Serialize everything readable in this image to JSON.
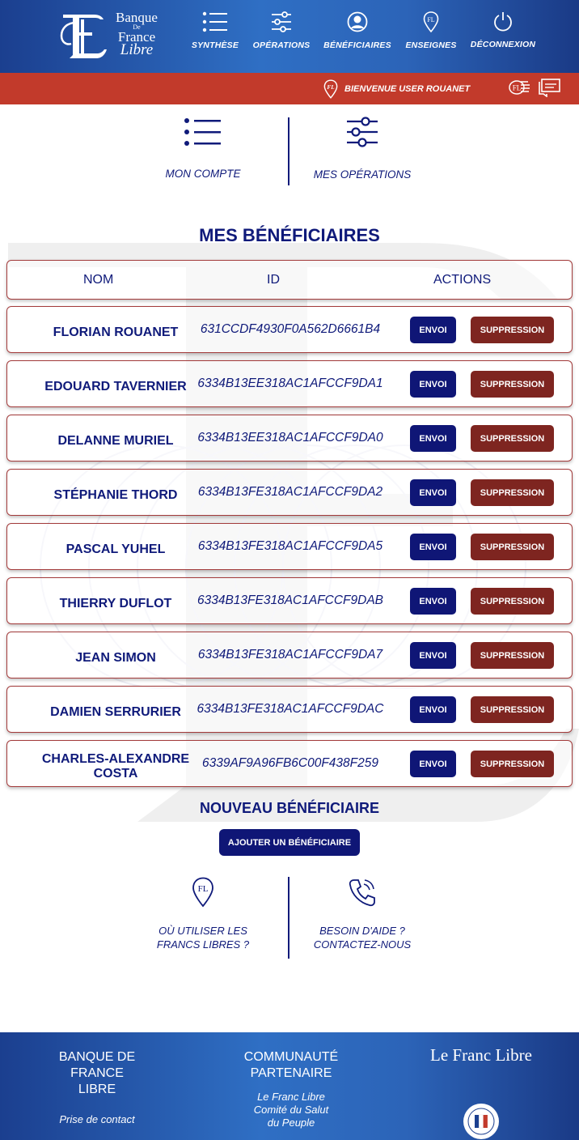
{
  "brand": {
    "line1": "Banque",
    "line2": "De",
    "line3": "France",
    "line4": "Libre"
  },
  "nav": [
    {
      "label": "SYNTHÈSE",
      "icon": "list-icon"
    },
    {
      "label": "OPÉRATIONS",
      "icon": "sliders-icon"
    },
    {
      "label": "BÉNÉFICIAIRES",
      "icon": "user-circle-icon"
    },
    {
      "label": "ENSEIGNES",
      "icon": "location-pin-icon"
    },
    {
      "label": "DÉCONNEXION",
      "icon": "power-icon"
    }
  ],
  "welcome": "BIENVENUE USER ROUANET",
  "quick_links": {
    "account": "MON COMPTE",
    "operations": "MES OPÉRATIONS"
  },
  "beneficiaries": {
    "title": "MES BÉNÉFICIAIRES",
    "columns": {
      "name": "NOM",
      "id": "ID",
      "actions": "ACTIONS"
    },
    "send_label": "ENVOI",
    "delete_label": "SUPPRESSION",
    "rows": [
      {
        "name": "FLORIAN ROUANET",
        "id": "631CCDF4930F0A562D6661B4"
      },
      {
        "name": "EDOUARD TAVERNIER",
        "id": "6334B13EE318AC1AFCCF9DA1"
      },
      {
        "name": "DELANNE MURIEL",
        "id": "6334B13EE318AC1AFCCF9DA0"
      },
      {
        "name": "STÉPHANIE THORD",
        "id": "6334B13FE318AC1AFCCF9DA2"
      },
      {
        "name": "PASCAL YUHEL",
        "id": "6334B13FE318AC1AFCCF9DA5"
      },
      {
        "name": "THIERRY DUFLOT",
        "id": "6334B13FE318AC1AFCCF9DAB"
      },
      {
        "name": "JEAN SIMON",
        "id": "6334B13FE318AC1AFCCF9DA7"
      },
      {
        "name": "DAMIEN SERRURIER",
        "id": "6334B13FE318AC1AFCCF9DAC"
      },
      {
        "name": "CHARLES-ALEXANDRE COSTA",
        "id": "6339AF9A96FB6C00F438F259"
      }
    ]
  },
  "new_beneficiary": {
    "title": "NOUVEAU BÉNÉFICIAIRE",
    "button": "AJOUTER UN BÉNÉFICIAIRE"
  },
  "help": {
    "where_line1": "OÙ UTILISER LES",
    "where_line2": "FRANCS LIBRES ?",
    "contact_line1": "BESOIN D'AIDE ?",
    "contact_line2": "CONTACTEZ-NOUS"
  },
  "footer": {
    "col1_line1": "BANQUE DE",
    "col1_line2": "FRANCE",
    "col1_line3": "LIBRE",
    "col1_link": "Prise de contact",
    "col2_line1": "COMMUNAUTÉ",
    "col2_line2": "PARTENAIRE",
    "col2_sub1": "Le Franc Libre",
    "col2_sub2": "Comité du Salut",
    "col2_sub3": "du Peuple",
    "col3_brand": "Le Franc Libre"
  },
  "colors": {
    "navy": "#0f1676",
    "header_blue": "#2f6fc4",
    "red_bar": "#c23a2b",
    "delete_red": "#7e2520"
  }
}
